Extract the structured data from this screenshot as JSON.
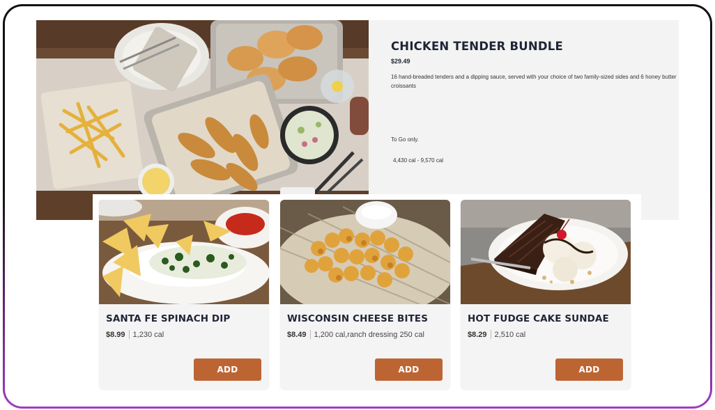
{
  "featured": {
    "title": "CHICKEN TENDER BUNDLE",
    "price": "$29.49",
    "description": "16 hand-breaded tenders and a dipping sauce, served with your choice of two family-sized sides and 6 honey butter croissants",
    "availability": "To Go only.",
    "calories": "4,430 cal - 9,570 cal"
  },
  "items": [
    {
      "title": "SANTA FE SPINACH DIP",
      "price": "$8.99",
      "calories": "1,230 cal",
      "button": "ADD"
    },
    {
      "title": "WISCONSIN CHEESE BITES",
      "price": "$8.49",
      "calories": "1,200 cal,ranch dressing 250 cal",
      "button": "ADD"
    },
    {
      "title": "HOT FUDGE CAKE SUNDAE",
      "price": "$8.29",
      "calories": "2,510 cal",
      "button": "ADD"
    }
  ],
  "colors": {
    "button": "#bc6533",
    "title": "#1e2536",
    "frame_accent": "#a23bc0"
  }
}
